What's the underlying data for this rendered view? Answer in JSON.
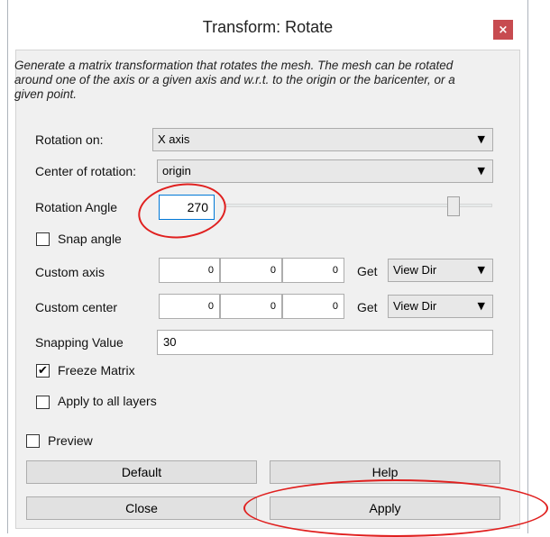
{
  "window": {
    "title": "Transform: Rotate",
    "close_label": "×"
  },
  "description": "Generate a matrix transformation that rotates the mesh. The mesh can be rotated around one of the axis or a given axis and w.r.t. to the origin or the baricenter, or a given point.",
  "rotation_on": {
    "label": "Rotation on:",
    "value": "X axis"
  },
  "center_of_rotation": {
    "label": "Center of rotation:",
    "value": "origin"
  },
  "rotation_angle": {
    "label": "Rotation Angle",
    "value": "270"
  },
  "snap_angle": {
    "label": "Snap angle",
    "checked": false
  },
  "custom_axis": {
    "label": "Custom axis",
    "values": [
      "0",
      "0",
      "0"
    ],
    "get_label": "Get",
    "dir_value": "View Dir"
  },
  "custom_center": {
    "label": "Custom center",
    "values": [
      "0",
      "0",
      "0"
    ],
    "get_label": "Get",
    "dir_value": "View Dir"
  },
  "snapping_value": {
    "label": "Snapping Value",
    "value": "30"
  },
  "freeze_matrix": {
    "label": "Freeze Matrix",
    "checked": true,
    "mark": "✔"
  },
  "apply_to_all_layers": {
    "label": "Apply to all layers",
    "checked": false
  },
  "preview": {
    "label": "Preview",
    "checked": false
  },
  "buttons": {
    "default": "Default",
    "help": "Help",
    "close": "Close",
    "apply": "Apply"
  },
  "icons": {
    "dropdown_arrow": "▼"
  },
  "colors": {
    "close_button": "#c74b50",
    "annotation": "#e0201f",
    "focus_border": "#0078d7"
  }
}
